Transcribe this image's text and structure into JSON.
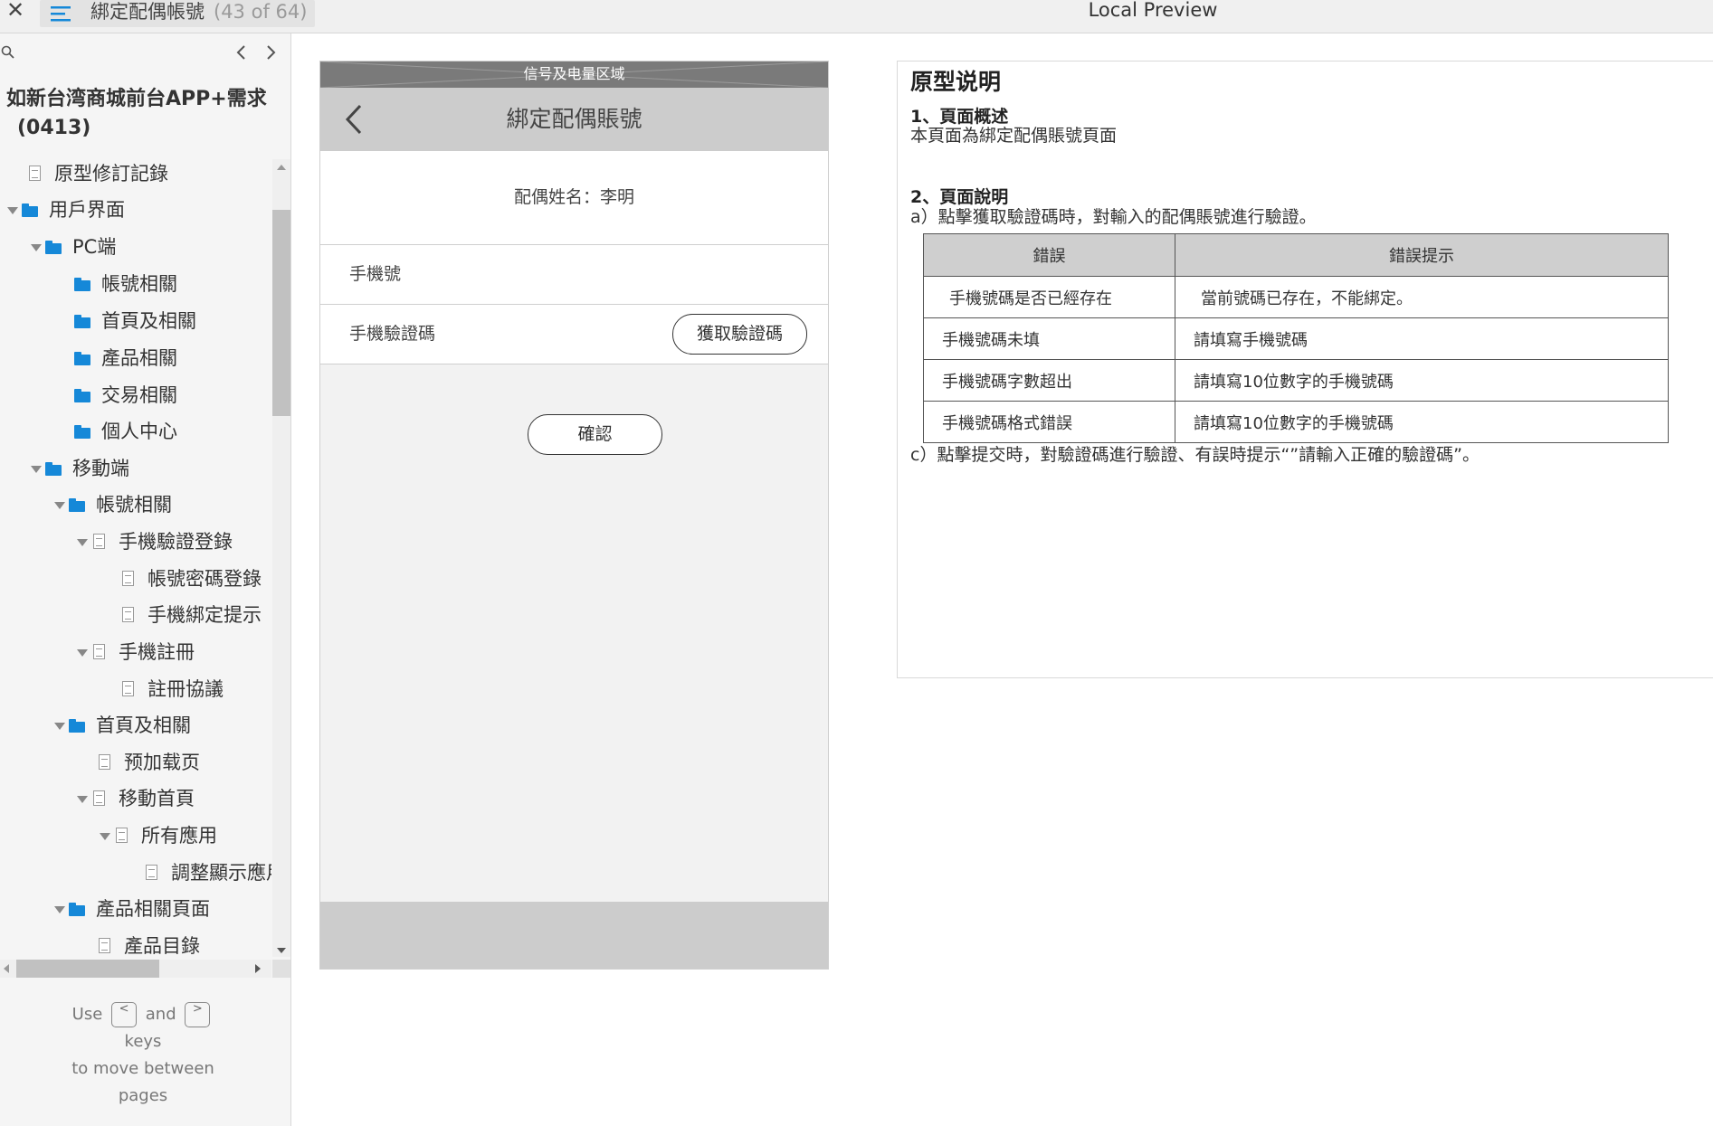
{
  "topbar": {
    "close_icon": "close-icon",
    "page_name": "綁定配偶帳號",
    "page_count": "(43 of 64)",
    "preview_title": "Local Preview"
  },
  "sidebar": {
    "project_title_line1": "如新台湾商城前台APP+需求",
    "project_title_line2": "(0413)",
    "tree": [
      {
        "label": "原型修訂記錄",
        "type": "page"
      },
      {
        "label": "用戶界面",
        "type": "folder",
        "expanded": true
      },
      {
        "label": "PC端",
        "type": "folder",
        "expanded": true
      },
      {
        "label": "帳號相關",
        "type": "folder"
      },
      {
        "label": "首頁及相關",
        "type": "folder"
      },
      {
        "label": "產品相關",
        "type": "folder"
      },
      {
        "label": "交易相關",
        "type": "folder"
      },
      {
        "label": "個人中心",
        "type": "folder"
      },
      {
        "label": "移動端",
        "type": "folder",
        "expanded": true
      },
      {
        "label": "帳號相關",
        "type": "folder",
        "expanded": true
      },
      {
        "label": "手機驗證登錄",
        "type": "page",
        "expanded": true
      },
      {
        "label": "帳號密碼登錄",
        "type": "page"
      },
      {
        "label": "手機綁定提示",
        "type": "page"
      },
      {
        "label": "手機註冊",
        "type": "page",
        "expanded": true
      },
      {
        "label": "註冊協議",
        "type": "page"
      },
      {
        "label": "首頁及相關",
        "type": "folder",
        "expanded": true
      },
      {
        "label": "预加载页",
        "type": "page"
      },
      {
        "label": "移動首頁",
        "type": "page",
        "expanded": true
      },
      {
        "label": "所有應用",
        "type": "page",
        "expanded": true
      },
      {
        "label": "調整顯示應用",
        "type": "page"
      },
      {
        "label": "產品相關頁面",
        "type": "folder",
        "expanded": true
      },
      {
        "label": "產品目錄",
        "type": "page"
      }
    ],
    "hint": {
      "use": "Use",
      "prev_key": "<",
      "and": "and",
      "next_key": ">",
      "keys": "keys",
      "line3": "to move between",
      "line4": "pages"
    }
  },
  "mockup": {
    "status_area": "信号及电量区域",
    "title": "綁定配偶賬號",
    "spouse_name": "配偶姓名：李明",
    "phone_label": "手機號",
    "code_label": "手機驗證碼",
    "get_code_button": "獲取驗證碼",
    "confirm_button": "確認"
  },
  "description": {
    "title": "原型说明",
    "section1_title": "1、頁面概述",
    "section1_text": "本頁面為綁定配偶賬號頁面",
    "section2_title": "2、頁面說明",
    "section2_a": "a）點擊獲取驗證碼時，對輸入的配偶賬號進行驗證。",
    "table_headers": [
      "錯誤",
      "錯誤提示"
    ],
    "table_rows": [
      [
        "手機號碼是否已經存在",
        "當前號碼已存在，不能綁定。"
      ],
      [
        "手機號碼未填",
        "請填寫手機號碼"
      ],
      [
        "手機號碼字數超出",
        "請填寫10位數字的手機號碼"
      ],
      [
        "手機號碼格式錯誤",
        "請填寫10位數字的手機號碼"
      ]
    ],
    "section2_c": "c）點擊提交時，對驗證碼進行驗證、有誤時提示“”請輸入正確的驗證碼”。"
  }
}
